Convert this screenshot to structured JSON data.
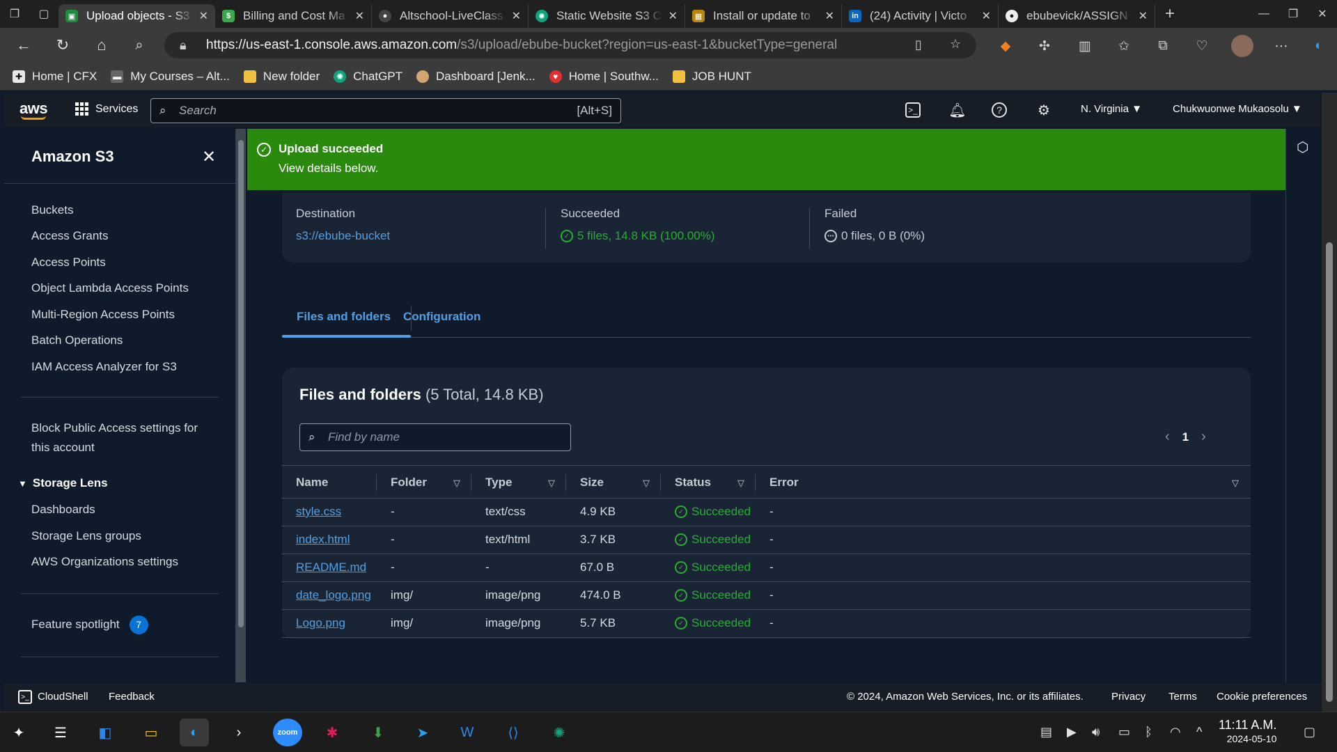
{
  "browser": {
    "tabs": [
      {
        "title": "Upload objects - S3",
        "active": true,
        "color": "#1e8e3e"
      },
      {
        "title": "Billing and Cost Ma",
        "active": false,
        "color": "#3aa84a"
      },
      {
        "title": "Altschool-LiveClass",
        "active": false,
        "color": "#555555"
      },
      {
        "title": "Static Website S3 C",
        "active": false,
        "color": "#10a37f"
      },
      {
        "title": "Install or update to",
        "active": false,
        "color": "#b8860b"
      },
      {
        "title": "(24) Activity | Victo",
        "active": false,
        "color": "#0a66c2"
      },
      {
        "title": "ebubevick/ASSIGN",
        "active": false,
        "color": "#f0f0f0"
      }
    ],
    "url_host": "https://us-east-1.console.aws.amazon.com",
    "url_path": "/s3/upload/ebube-bucket?region=us-east-1&bucketType=general",
    "favorites": [
      {
        "label": "Home | CFX",
        "color": "#e8e8e8"
      },
      {
        "label": "My Courses – Alt...",
        "color": "#888888"
      },
      {
        "label": "New folder",
        "color": "#f0c040"
      },
      {
        "label": "ChatGPT",
        "color": "#10a37f"
      },
      {
        "label": "Dashboard [Jenk...",
        "color": "#d4a574"
      },
      {
        "label": "Home | Southw...",
        "color": "#e03030"
      },
      {
        "label": "JOB HUNT",
        "color": "#f0c040"
      }
    ]
  },
  "aws": {
    "logo": "aws",
    "services_label": "Services",
    "search_placeholder": "Search",
    "search_shortcut": "[Alt+S]",
    "region": "N. Virginia ▼",
    "user": "Chukwuonwe Mukaosolu ▼"
  },
  "sidebar": {
    "title": "Amazon S3",
    "items": [
      "Buckets",
      "Access Grants",
      "Access Points",
      "Object Lambda Access Points",
      "Multi-Region Access Points",
      "Batch Operations",
      "IAM Access Analyzer for S3"
    ],
    "block_public": "Block Public Access settings for this account",
    "storage_lens": "Storage Lens",
    "storage_items": [
      "Dashboards",
      "Storage Lens groups",
      "AWS Organizations settings"
    ],
    "feature_spotlight": "Feature spotlight",
    "feature_count": "7"
  },
  "flash": {
    "header": "Upload succeeded",
    "message": "View details below."
  },
  "summary": {
    "destination_label": "Destination",
    "destination_value": "s3://ebube-bucket",
    "succeeded_label": "Succeeded",
    "succeeded_value": "5 files, 14.8 KB (100.00%)",
    "failed_label": "Failed",
    "failed_value": "0 files, 0 B (0%)"
  },
  "tabs": {
    "files": "Files and folders",
    "config": "Configuration"
  },
  "panel": {
    "title": "Files and folders",
    "count": "(5 Total, 14.8 KB)",
    "find_placeholder": "Find by name",
    "page": "1",
    "columns": [
      "Name",
      "Folder",
      "Type",
      "Size",
      "Status",
      "Error"
    ],
    "rows": [
      {
        "name": "style.css",
        "folder": "-",
        "type": "text/css",
        "size": "4.9 KB",
        "status": "Succeeded",
        "error": "-"
      },
      {
        "name": "index.html",
        "folder": "-",
        "type": "text/html",
        "size": "3.7 KB",
        "status": "Succeeded",
        "error": "-"
      },
      {
        "name": "README.md",
        "folder": "-",
        "type": "-",
        "size": "67.0 B",
        "status": "Succeeded",
        "error": "-"
      },
      {
        "name": "date_logo.png",
        "folder": "img/",
        "type": "image/png",
        "size": "474.0 B",
        "status": "Succeeded",
        "error": "-"
      },
      {
        "name": "Logo.png",
        "folder": "img/",
        "type": "image/png",
        "size": "5.7 KB",
        "status": "Succeeded",
        "error": "-"
      }
    ]
  },
  "footer": {
    "cloudshell": "CloudShell",
    "feedback": "Feedback",
    "copyright": "© 2024, Amazon Web Services, Inc. or its affiliates.",
    "privacy": "Privacy",
    "terms": "Terms",
    "cookies": "Cookie preferences"
  },
  "taskbar": {
    "time": "11:11 A.M.",
    "date": "2024-05-10",
    "zoom_label": "zoom"
  },
  "colors": {
    "success": "#2a8a0e",
    "link": "#539fe5",
    "status_green": "#29ad32"
  }
}
